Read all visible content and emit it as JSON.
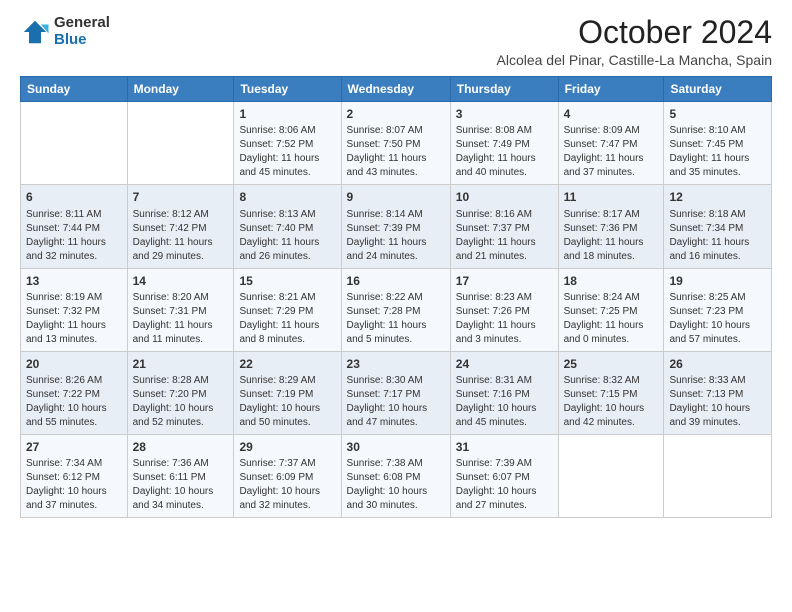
{
  "logo": {
    "general": "General",
    "blue": "Blue"
  },
  "header": {
    "title": "October 2024",
    "subtitle": "Alcolea del Pinar, Castille-La Mancha, Spain"
  },
  "weekdays": [
    "Sunday",
    "Monday",
    "Tuesday",
    "Wednesday",
    "Thursday",
    "Friday",
    "Saturday"
  ],
  "weeks": [
    [
      {
        "day": "",
        "info": ""
      },
      {
        "day": "",
        "info": ""
      },
      {
        "day": "1",
        "info": "Sunrise: 8:06 AM\nSunset: 7:52 PM\nDaylight: 11 hours and 45 minutes."
      },
      {
        "day": "2",
        "info": "Sunrise: 8:07 AM\nSunset: 7:50 PM\nDaylight: 11 hours and 43 minutes."
      },
      {
        "day": "3",
        "info": "Sunrise: 8:08 AM\nSunset: 7:49 PM\nDaylight: 11 hours and 40 minutes."
      },
      {
        "day": "4",
        "info": "Sunrise: 8:09 AM\nSunset: 7:47 PM\nDaylight: 11 hours and 37 minutes."
      },
      {
        "day": "5",
        "info": "Sunrise: 8:10 AM\nSunset: 7:45 PM\nDaylight: 11 hours and 35 minutes."
      }
    ],
    [
      {
        "day": "6",
        "info": "Sunrise: 8:11 AM\nSunset: 7:44 PM\nDaylight: 11 hours and 32 minutes."
      },
      {
        "day": "7",
        "info": "Sunrise: 8:12 AM\nSunset: 7:42 PM\nDaylight: 11 hours and 29 minutes."
      },
      {
        "day": "8",
        "info": "Sunrise: 8:13 AM\nSunset: 7:40 PM\nDaylight: 11 hours and 26 minutes."
      },
      {
        "day": "9",
        "info": "Sunrise: 8:14 AM\nSunset: 7:39 PM\nDaylight: 11 hours and 24 minutes."
      },
      {
        "day": "10",
        "info": "Sunrise: 8:16 AM\nSunset: 7:37 PM\nDaylight: 11 hours and 21 minutes."
      },
      {
        "day": "11",
        "info": "Sunrise: 8:17 AM\nSunset: 7:36 PM\nDaylight: 11 hours and 18 minutes."
      },
      {
        "day": "12",
        "info": "Sunrise: 8:18 AM\nSunset: 7:34 PM\nDaylight: 11 hours and 16 minutes."
      }
    ],
    [
      {
        "day": "13",
        "info": "Sunrise: 8:19 AM\nSunset: 7:32 PM\nDaylight: 11 hours and 13 minutes."
      },
      {
        "day": "14",
        "info": "Sunrise: 8:20 AM\nSunset: 7:31 PM\nDaylight: 11 hours and 11 minutes."
      },
      {
        "day": "15",
        "info": "Sunrise: 8:21 AM\nSunset: 7:29 PM\nDaylight: 11 hours and 8 minutes."
      },
      {
        "day": "16",
        "info": "Sunrise: 8:22 AM\nSunset: 7:28 PM\nDaylight: 11 hours and 5 minutes."
      },
      {
        "day": "17",
        "info": "Sunrise: 8:23 AM\nSunset: 7:26 PM\nDaylight: 11 hours and 3 minutes."
      },
      {
        "day": "18",
        "info": "Sunrise: 8:24 AM\nSunset: 7:25 PM\nDaylight: 11 hours and 0 minutes."
      },
      {
        "day": "19",
        "info": "Sunrise: 8:25 AM\nSunset: 7:23 PM\nDaylight: 10 hours and 57 minutes."
      }
    ],
    [
      {
        "day": "20",
        "info": "Sunrise: 8:26 AM\nSunset: 7:22 PM\nDaylight: 10 hours and 55 minutes."
      },
      {
        "day": "21",
        "info": "Sunrise: 8:28 AM\nSunset: 7:20 PM\nDaylight: 10 hours and 52 minutes."
      },
      {
        "day": "22",
        "info": "Sunrise: 8:29 AM\nSunset: 7:19 PM\nDaylight: 10 hours and 50 minutes."
      },
      {
        "day": "23",
        "info": "Sunrise: 8:30 AM\nSunset: 7:17 PM\nDaylight: 10 hours and 47 minutes."
      },
      {
        "day": "24",
        "info": "Sunrise: 8:31 AM\nSunset: 7:16 PM\nDaylight: 10 hours and 45 minutes."
      },
      {
        "day": "25",
        "info": "Sunrise: 8:32 AM\nSunset: 7:15 PM\nDaylight: 10 hours and 42 minutes."
      },
      {
        "day": "26",
        "info": "Sunrise: 8:33 AM\nSunset: 7:13 PM\nDaylight: 10 hours and 39 minutes."
      }
    ],
    [
      {
        "day": "27",
        "info": "Sunrise: 7:34 AM\nSunset: 6:12 PM\nDaylight: 10 hours and 37 minutes."
      },
      {
        "day": "28",
        "info": "Sunrise: 7:36 AM\nSunset: 6:11 PM\nDaylight: 10 hours and 34 minutes."
      },
      {
        "day": "29",
        "info": "Sunrise: 7:37 AM\nSunset: 6:09 PM\nDaylight: 10 hours and 32 minutes."
      },
      {
        "day": "30",
        "info": "Sunrise: 7:38 AM\nSunset: 6:08 PM\nDaylight: 10 hours and 30 minutes."
      },
      {
        "day": "31",
        "info": "Sunrise: 7:39 AM\nSunset: 6:07 PM\nDaylight: 10 hours and 27 minutes."
      },
      {
        "day": "",
        "info": ""
      },
      {
        "day": "",
        "info": ""
      }
    ]
  ],
  "colors": {
    "header_bg": "#3a7ebf",
    "row_odd": "#f5f8fc",
    "row_even": "#e8eef5"
  }
}
